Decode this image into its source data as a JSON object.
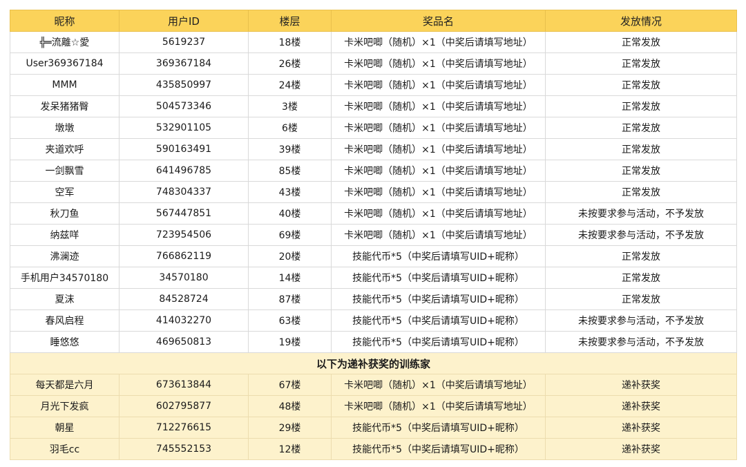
{
  "columns": [
    "昵称",
    "用户ID",
    "楼层",
    "奖品名",
    "发放情况"
  ],
  "rows": [
    {
      "nickname": "╬═流離☆愛",
      "uid": "5619237",
      "floor": "18楼",
      "prize": "卡米吧唧（随机）×1（中奖后请填写地址）",
      "status": "正常发放"
    },
    {
      "nickname": "User369367184",
      "uid": "369367184",
      "floor": "26楼",
      "prize": "卡米吧唧（随机）×1（中奖后请填写地址）",
      "status": "正常发放"
    },
    {
      "nickname": "MMM",
      "uid": "435850997",
      "floor": "24楼",
      "prize": "卡米吧唧（随机）×1（中奖后请填写地址）",
      "status": "正常发放"
    },
    {
      "nickname": "发呆猪猪臀",
      "uid": "504573346",
      "floor": "3楼",
      "prize": "卡米吧唧（随机）×1（中奖后请填写地址）",
      "status": "正常发放"
    },
    {
      "nickname": "墩墩",
      "uid": "532901105",
      "floor": "6楼",
      "prize": "卡米吧唧（随机）×1（中奖后请填写地址）",
      "status": "正常发放"
    },
    {
      "nickname": "夹道欢呼",
      "uid": "590163491",
      "floor": "39楼",
      "prize": "卡米吧唧（随机）×1（中奖后请填写地址）",
      "status": "正常发放"
    },
    {
      "nickname": "一剑飘雪",
      "uid": "641496785",
      "floor": "85楼",
      "prize": "卡米吧唧（随机）×1（中奖后请填写地址）",
      "status": "正常发放"
    },
    {
      "nickname": "空军",
      "uid": "748304337",
      "floor": "43楼",
      "prize": "卡米吧唧（随机）×1（中奖后请填写地址）",
      "status": "正常发放"
    },
    {
      "nickname": "秋刀鱼",
      "uid": "567447851",
      "floor": "40楼",
      "prize": "卡米吧唧（随机）×1（中奖后请填写地址）",
      "status": "未按要求参与活动，不予发放"
    },
    {
      "nickname": "纳兹咩",
      "uid": "723954506",
      "floor": "69楼",
      "prize": "卡米吧唧（随机）×1（中奖后请填写地址）",
      "status": "未按要求参与活动，不予发放"
    },
    {
      "nickname": "沸澜迹",
      "uid": "766862119",
      "floor": "20楼",
      "prize": "技能代币*5（中奖后请填写UID+昵称）",
      "status": "正常发放"
    },
    {
      "nickname": "手机用户34570180",
      "uid": "34570180",
      "floor": "14楼",
      "prize": "技能代币*5（中奖后请填写UID+昵称）",
      "status": "正常发放"
    },
    {
      "nickname": "夏沫",
      "uid": "84528724",
      "floor": "87楼",
      "prize": "技能代币*5（中奖后请填写UID+昵称）",
      "status": "正常发放"
    },
    {
      "nickname": "春风启程",
      "uid": "414032270",
      "floor": "63楼",
      "prize": "技能代币*5（中奖后请填写UID+昵称）",
      "status": "未按要求参与活动，不予发放"
    },
    {
      "nickname": "睡悠悠",
      "uid": "469650813",
      "floor": "19楼",
      "prize": "技能代币*5（中奖后请填写UID+昵称）",
      "status": "未按要求参与活动，不予发放"
    }
  ],
  "section_title": "以下为递补获奖的训练家",
  "makeup_rows": [
    {
      "nickname": "每天都是六月",
      "uid": "673613844",
      "floor": "67楼",
      "prize": "卡米吧唧（随机）×1（中奖后请填写地址）",
      "status": "递补获奖"
    },
    {
      "nickname": "月光下发疯",
      "uid": "602795877",
      "floor": "48楼",
      "prize": "卡米吧唧（随机）×1（中奖后请填写地址）",
      "status": "递补获奖"
    },
    {
      "nickname": "朝星",
      "uid": "712276615",
      "floor": "29楼",
      "prize": "技能代币*5（中奖后请填写UID+昵称）",
      "status": "递补获奖"
    },
    {
      "nickname": "羽毛cc",
      "uid": "745552153",
      "floor": "12楼",
      "prize": "技能代币*5（中奖后请填写UID+昵称）",
      "status": "递补获奖"
    }
  ],
  "colors": {
    "header_bg": "#fbd35a",
    "makeup_bg": "#fdf2cc",
    "grid": "#d9d9d9"
  }
}
